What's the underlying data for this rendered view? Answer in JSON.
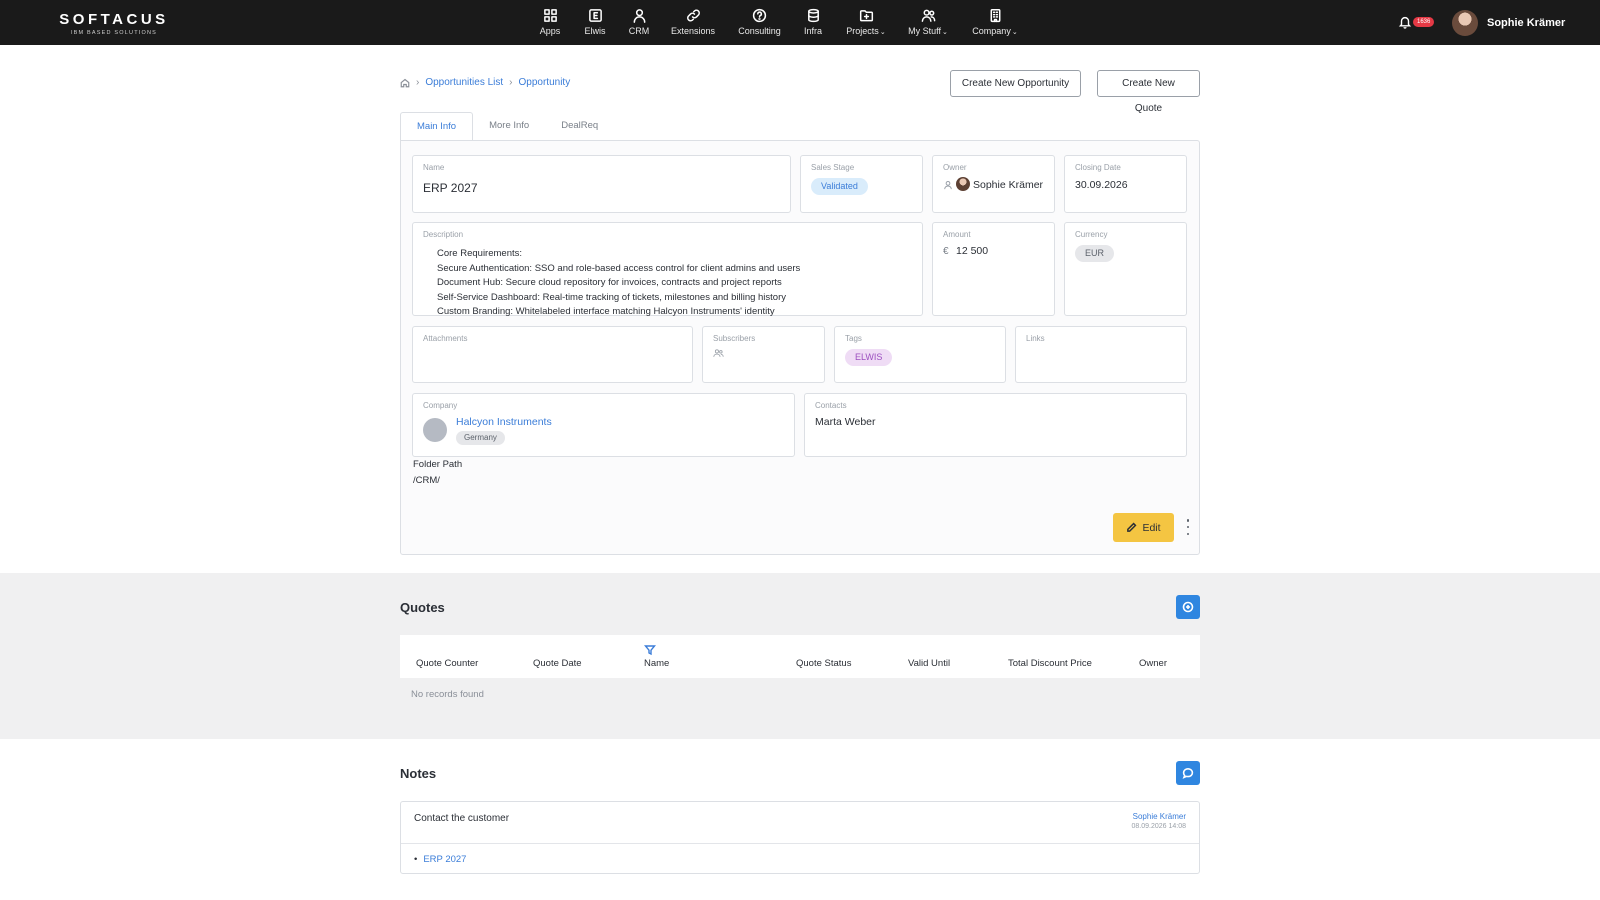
{
  "topbar": {
    "brand": "SOFTACUS",
    "brand_sub": "IBM BASED SOLUTIONS",
    "nav": [
      {
        "label": "Apps",
        "icon": "grid-icon"
      },
      {
        "label": "Elwis",
        "icon": "elwis-icon"
      },
      {
        "label": "CRM",
        "icon": "user-icon"
      },
      {
        "label": "Extensions",
        "icon": "link-icon"
      },
      {
        "label": "Consulting",
        "icon": "help-circle-icon"
      },
      {
        "label": "Infra",
        "icon": "database-icon"
      },
      {
        "label": "Projects",
        "icon": "folder-plus-icon",
        "dropdown": true
      },
      {
        "label": "My Stuff",
        "icon": "users-icon",
        "dropdown": true
      },
      {
        "label": "Company",
        "icon": "building-icon",
        "dropdown": true
      }
    ],
    "notification_count": "1636",
    "user_name": "Sophie Krämer"
  },
  "breadcrumb": {
    "items": [
      "Opportunities List",
      "Opportunity"
    ]
  },
  "actions": {
    "create_opportunity": "Create New Opportunity",
    "create_quote": "Create New Quote"
  },
  "tabs": [
    "Main Info",
    "More Info",
    "DealReq"
  ],
  "opportunity": {
    "name_label": "Name",
    "name": "ERP 2027",
    "stage_label": "Sales Stage",
    "stage": "Validated",
    "owner_label": "Owner",
    "owner": "Sophie Krämer",
    "closing_label": "Closing Date",
    "closing_date": "30.09.2026",
    "description_label": "Description",
    "description": [
      "Core Requirements:",
      "Secure Authentication: SSO and role-based access control for client admins and users",
      "Document Hub: Secure cloud repository for invoices, contracts and project reports",
      "Self-Service Dashboard: Real-time tracking of tickets, milestones and billing history",
      "Custom Branding: Whitelabeled interface matching Halcyon Instruments' identity"
    ],
    "amount_label": "Amount",
    "currency_symbol": "€",
    "amount": "12 500",
    "currency_label": "Currency",
    "currency": "EUR",
    "attachments_label": "Attachments",
    "subscribers_label": "Subscribers",
    "tags_label": "Tags",
    "tag": "ELWIS",
    "links_label": "Links",
    "company_label": "Company",
    "company": "Halcyon Instruments",
    "company_country": "Germany",
    "contacts_label": "Contacts",
    "contact": "Marta Weber",
    "folder_path_label": "Folder Path",
    "folder_path": "/CRM/",
    "edit_label": "Edit"
  },
  "quotes": {
    "title": "Quotes",
    "columns": [
      "Quote Counter",
      "Quote Date",
      "Name",
      "Quote Status",
      "Valid Until",
      "Total Discount Price",
      "Owner"
    ],
    "empty_text": "No records found"
  },
  "notes": {
    "title": "Notes",
    "items": [
      {
        "title": "Contact the customer",
        "author": "Sophie Krämer",
        "date": "08.09.2026 14:08",
        "link": "ERP 2027"
      }
    ]
  },
  "colors": {
    "topbar": "#1a1a1a",
    "link": "#3b7dd8",
    "edit_button": "#f4c542",
    "primary_button": "#2f86e0"
  }
}
